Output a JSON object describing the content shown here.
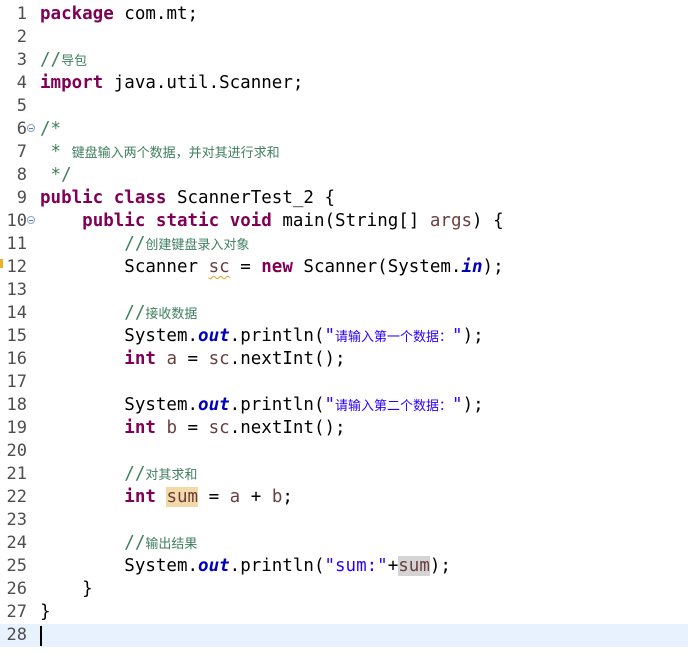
{
  "editor": {
    "lines": [
      {
        "n": "1",
        "segs": [
          [
            "kw",
            "package"
          ],
          [
            "t",
            " com.mt;"
          ]
        ]
      },
      {
        "n": "2",
        "segs": []
      },
      {
        "n": "3",
        "segs": [
          [
            "cm",
            "//"
          ],
          [
            "cmz",
            "导包"
          ]
        ]
      },
      {
        "n": "4",
        "segs": [
          [
            "kw",
            "import"
          ],
          [
            "t",
            " java.util.Scanner;"
          ]
        ]
      },
      {
        "n": "5",
        "segs": []
      },
      {
        "n": "6",
        "fold": true,
        "segs": [
          [
            "cm",
            "/*"
          ]
        ]
      },
      {
        "n": "7",
        "segs": [
          [
            "cm",
            " * "
          ],
          [
            "cmz",
            "键盘输入两个数据，并对其进行求和"
          ]
        ]
      },
      {
        "n": "8",
        "segs": [
          [
            "cm",
            " */"
          ]
        ]
      },
      {
        "n": "9",
        "segs": [
          [
            "kw",
            "public"
          ],
          [
            "t",
            " "
          ],
          [
            "kw",
            "class"
          ],
          [
            "t",
            " ScannerTest_2 {"
          ]
        ]
      },
      {
        "n": "10",
        "fold": true,
        "segs": [
          [
            "t",
            "    "
          ],
          [
            "kw",
            "public"
          ],
          [
            "t",
            " "
          ],
          [
            "kw",
            "static"
          ],
          [
            "t",
            " "
          ],
          [
            "kw",
            "void"
          ],
          [
            "t",
            " main(String[] "
          ],
          [
            "var",
            "args"
          ],
          [
            "t",
            ") {"
          ]
        ]
      },
      {
        "n": "11",
        "segs": [
          [
            "t",
            "        "
          ],
          [
            "cm",
            "//"
          ],
          [
            "cmz",
            "创建键盘录入对象"
          ]
        ]
      },
      {
        "n": "12",
        "warn": true,
        "segs": [
          [
            "t",
            "        Scanner "
          ],
          [
            "varsq",
            "sc"
          ],
          [
            "t",
            " = "
          ],
          [
            "kw",
            "new"
          ],
          [
            "t",
            " Scanner(System."
          ],
          [
            "fld",
            "in"
          ],
          [
            "t",
            ");"
          ]
        ]
      },
      {
        "n": "13",
        "segs": []
      },
      {
        "n": "14",
        "segs": [
          [
            "t",
            "        "
          ],
          [
            "cm",
            "//"
          ],
          [
            "cmz",
            "接收数据"
          ]
        ]
      },
      {
        "n": "15",
        "segs": [
          [
            "t",
            "        System."
          ],
          [
            "fld",
            "out"
          ],
          [
            "t",
            ".println("
          ],
          [
            "str",
            "\""
          ],
          [
            "strz",
            "请输入第一个数据："
          ],
          [
            "str",
            "\""
          ],
          [
            "t",
            ");"
          ]
        ]
      },
      {
        "n": "16",
        "segs": [
          [
            "t",
            "        "
          ],
          [
            "kw",
            "int"
          ],
          [
            "t",
            " "
          ],
          [
            "var",
            "a"
          ],
          [
            "t",
            " = "
          ],
          [
            "var",
            "sc"
          ],
          [
            "t",
            ".nextInt();"
          ]
        ]
      },
      {
        "n": "17",
        "segs": []
      },
      {
        "n": "18",
        "segs": [
          [
            "t",
            "        System."
          ],
          [
            "fld",
            "out"
          ],
          [
            "t",
            ".println("
          ],
          [
            "str",
            "\""
          ],
          [
            "strz",
            "请输入第二个数据："
          ],
          [
            "str",
            "\""
          ],
          [
            "t",
            ");"
          ]
        ]
      },
      {
        "n": "19",
        "segs": [
          [
            "t",
            "        "
          ],
          [
            "kw",
            "int"
          ],
          [
            "t",
            " "
          ],
          [
            "var",
            "b"
          ],
          [
            "t",
            " = "
          ],
          [
            "var",
            "sc"
          ],
          [
            "t",
            ".nextInt();"
          ]
        ]
      },
      {
        "n": "20",
        "segs": []
      },
      {
        "n": "21",
        "segs": [
          [
            "t",
            "        "
          ],
          [
            "cm",
            "//"
          ],
          [
            "cmz",
            "对其求和"
          ]
        ]
      },
      {
        "n": "22",
        "segs": [
          [
            "t",
            "        "
          ],
          [
            "kw",
            "int"
          ],
          [
            "t",
            " "
          ],
          [
            "vardecl",
            "sum"
          ],
          [
            "t",
            " = "
          ],
          [
            "var",
            "a"
          ],
          [
            "t",
            " + "
          ],
          [
            "var",
            "b"
          ],
          [
            "t",
            ";"
          ]
        ]
      },
      {
        "n": "23",
        "segs": []
      },
      {
        "n": "24",
        "segs": [
          [
            "t",
            "        "
          ],
          [
            "cm",
            "//"
          ],
          [
            "cmz",
            "输出结果"
          ]
        ]
      },
      {
        "n": "25",
        "segs": [
          [
            "t",
            "        System."
          ],
          [
            "fld",
            "out"
          ],
          [
            "t",
            ".println("
          ],
          [
            "str",
            "\"sum:\""
          ],
          [
            "t",
            "+"
          ],
          [
            "varread",
            "sum"
          ],
          [
            "t",
            ");"
          ]
        ]
      },
      {
        "n": "26",
        "segs": [
          [
            "t",
            "    }"
          ]
        ]
      },
      {
        "n": "27",
        "segs": [
          [
            "t",
            "}"
          ]
        ]
      },
      {
        "n": "28",
        "current": true,
        "segs": []
      }
    ]
  }
}
